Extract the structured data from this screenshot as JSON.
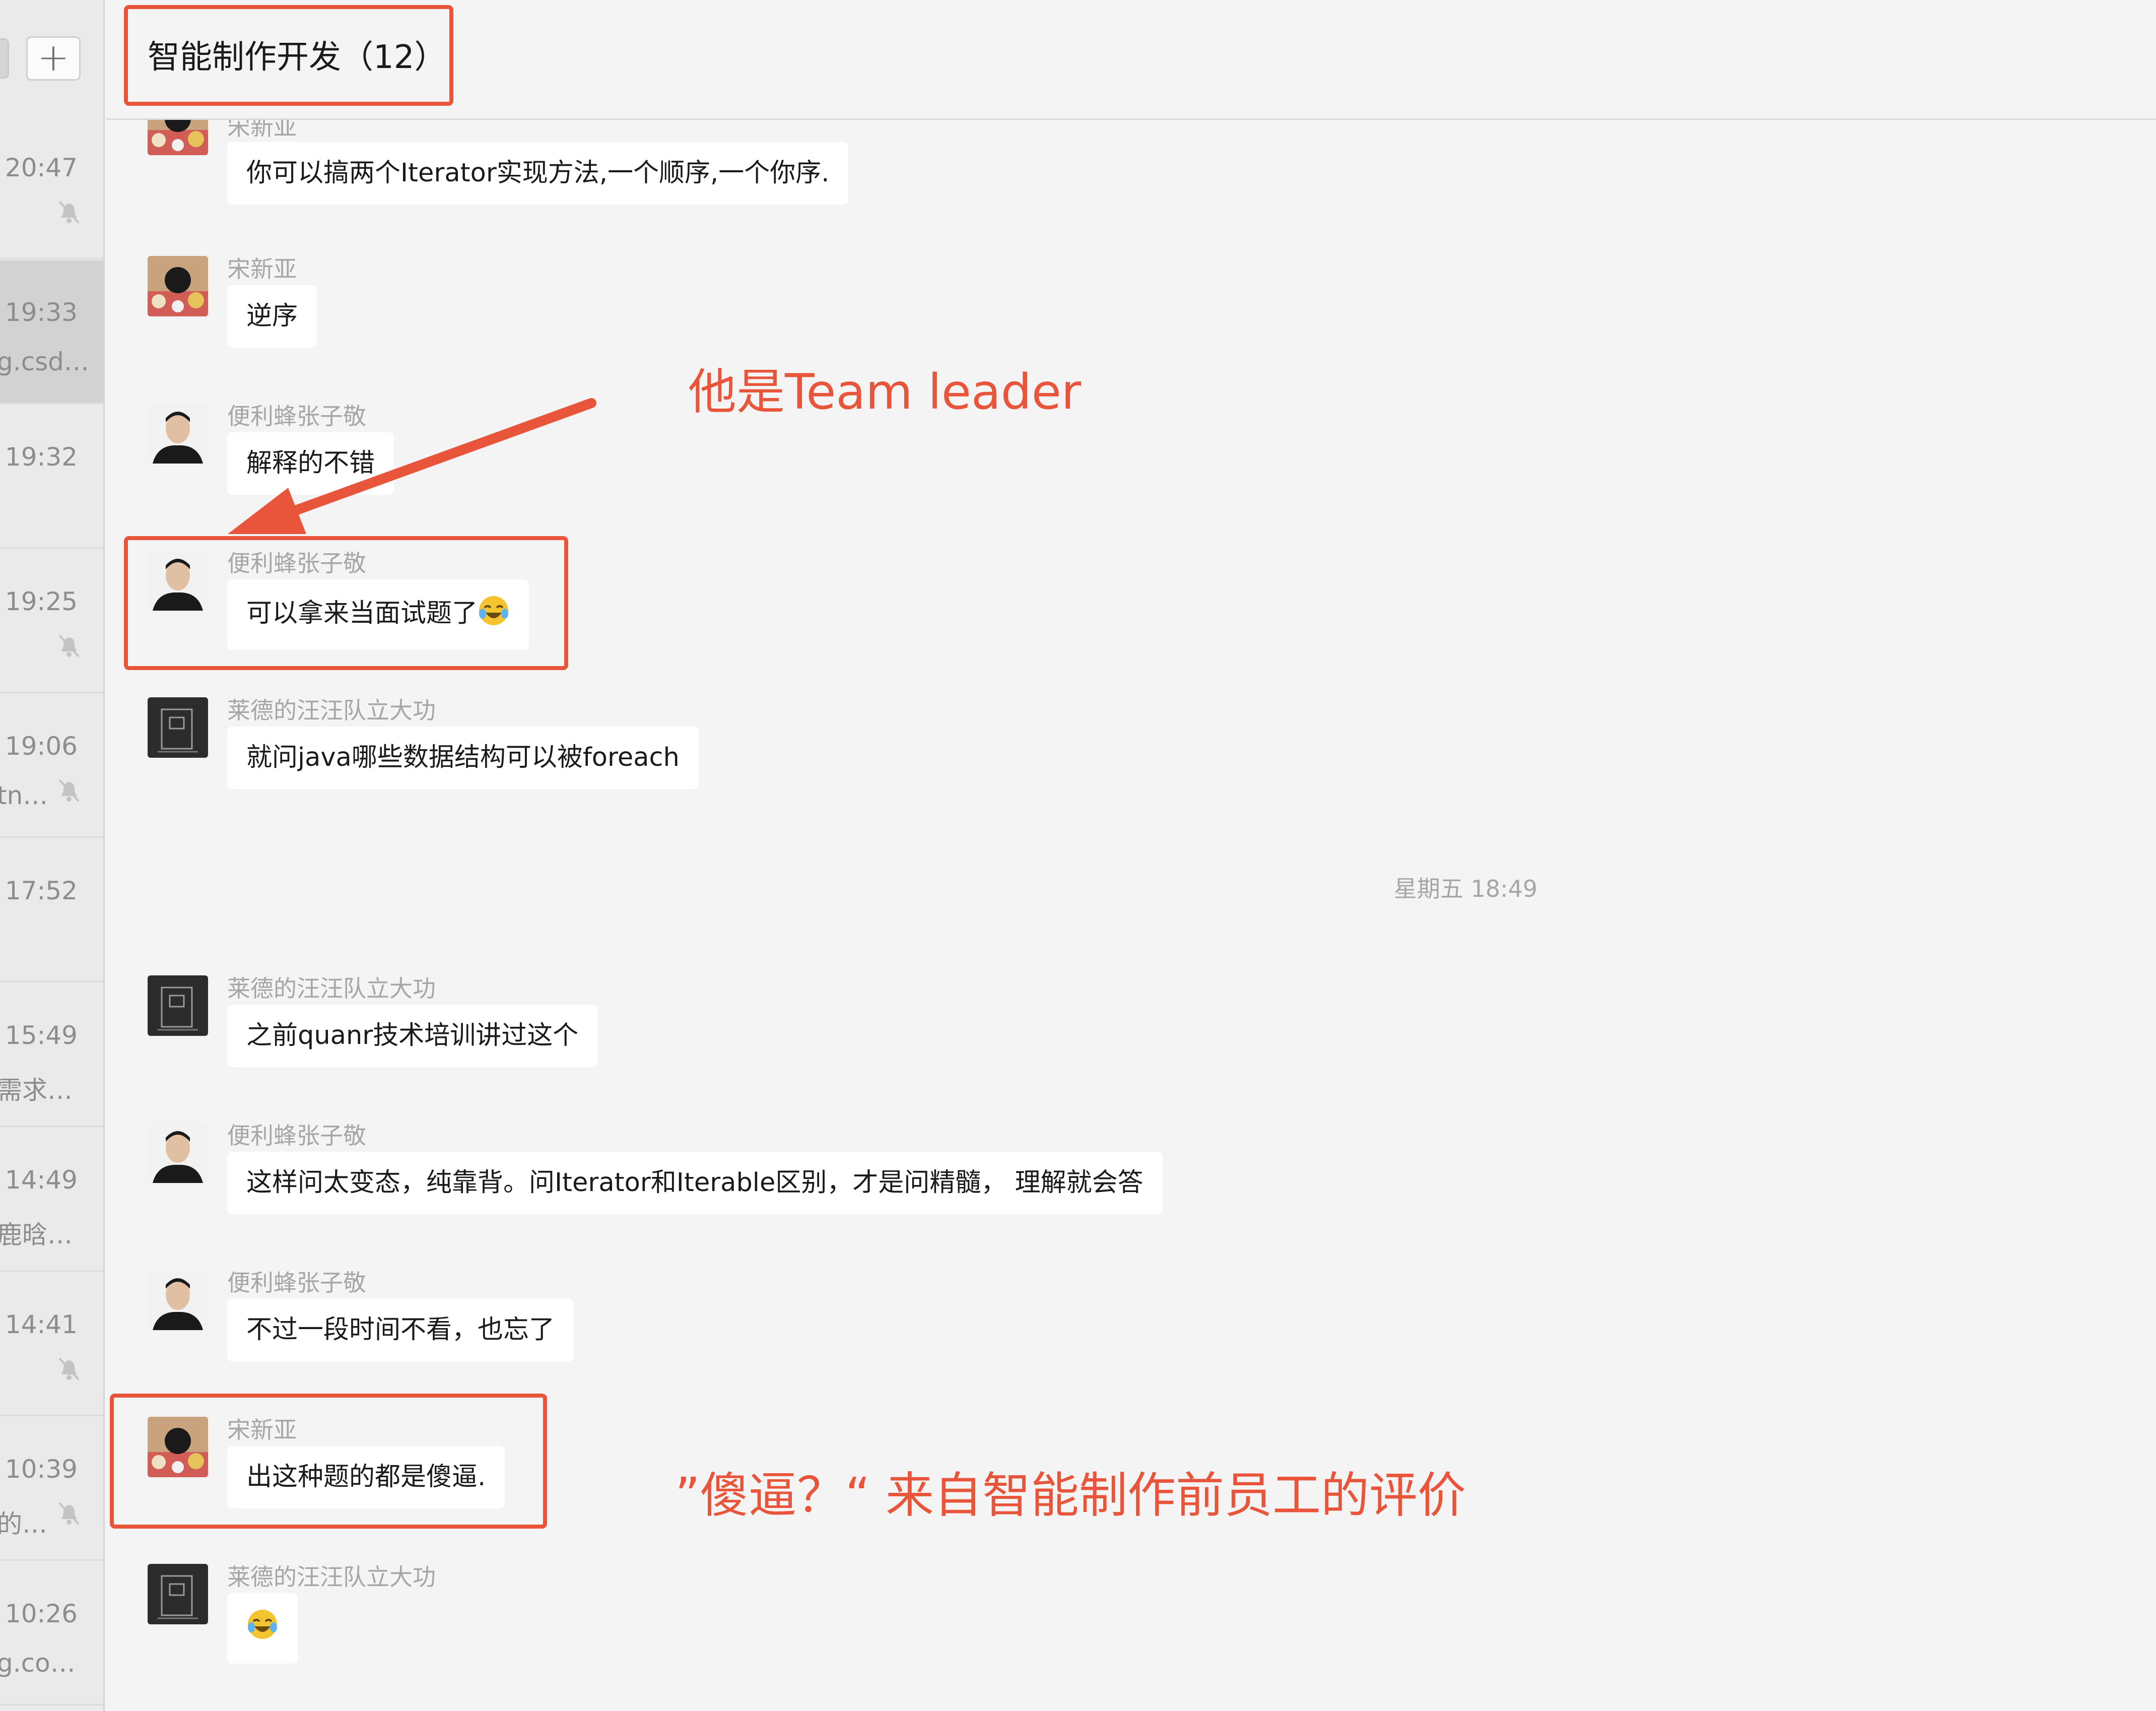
{
  "sidebar": {
    "add_button_label": "+",
    "items": [
      {
        "time": "20:47",
        "preview": "",
        "muted": true,
        "active": false
      },
      {
        "time": "19:33",
        "preview": "g.csd…",
        "muted": false,
        "active": true
      },
      {
        "time": "19:32",
        "preview": "",
        "muted": false,
        "active": false
      },
      {
        "time": "19:25",
        "preview": "",
        "muted": true,
        "active": false
      },
      {
        "time": "19:06",
        "preview": "tn…",
        "muted": true,
        "active": false
      },
      {
        "time": "17:52",
        "preview": "",
        "muted": false,
        "active": false
      },
      {
        "time": "15:49",
        "preview": "需求…",
        "muted": false,
        "active": false
      },
      {
        "time": "14:49",
        "preview": "鹿晗…",
        "muted": false,
        "active": false
      },
      {
        "time": "14:41",
        "preview": "",
        "muted": true,
        "active": false
      },
      {
        "time": "10:39",
        "preview": "的…",
        "muted": true,
        "active": false
      },
      {
        "time": "10:26",
        "preview": "g.co…",
        "muted": false,
        "active": false
      }
    ]
  },
  "header": {
    "title": "智能制作开发（12）"
  },
  "messages": [
    {
      "sender": "宋新亚",
      "text": "你可以搞两个Iterator实现方法,一个顺序,一个你序."
    },
    {
      "sender": "宋新亚",
      "text": "逆序"
    },
    {
      "sender": "便利蜂张子敬",
      "text": "解释的不错"
    },
    {
      "sender": "便利蜂张子敬",
      "text": "可以拿来当面试题了"
    },
    {
      "sender": "莱德的汪汪队立大功",
      "text": "就问java哪些数据结构可以被foreach"
    },
    {
      "sender": "莱德的汪汪队立大功",
      "text": "之前quanr技术培训讲过这个"
    },
    {
      "sender": "便利蜂张子敬",
      "text": "这样问太变态，纯靠背。问Iterator和Iterable区别，才是问精髓， 理解就会答"
    },
    {
      "sender": "便利蜂张子敬",
      "text": "不过一段时间不看，也忘了"
    },
    {
      "sender": "宋新亚",
      "text": "出这种题的都是傻逼."
    },
    {
      "sender": "莱德的汪汪队立大功",
      "text": ""
    }
  ],
  "date_divider": "星期五 18:49",
  "annotations": {
    "leader_note": "他是Team leader",
    "quote_note": "”傻逼？“ 来自智能制作前员工的评价",
    "color": "#e8553a"
  }
}
